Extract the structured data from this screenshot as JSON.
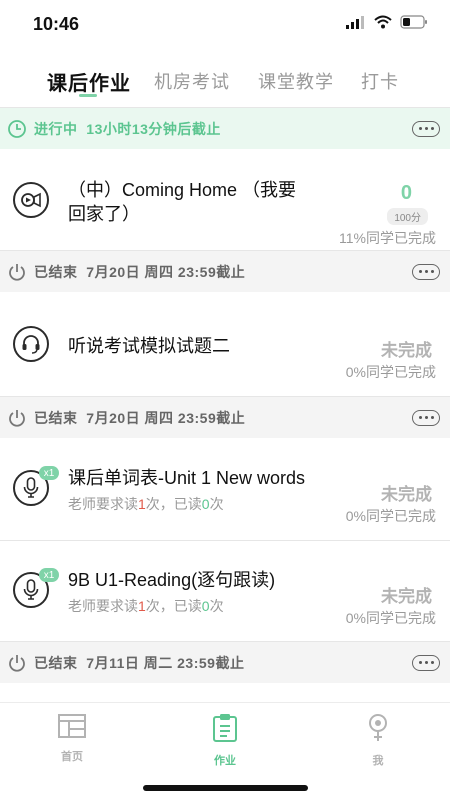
{
  "status_bar": {
    "time": "10:46"
  },
  "tabs": [
    {
      "label": "课后作业",
      "active": true
    },
    {
      "label": "机房考试",
      "active": false
    },
    {
      "label": "课堂教学",
      "active": false
    },
    {
      "label": "打卡",
      "active": false
    }
  ],
  "sections": [
    {
      "state": "进行中",
      "deadline": "13小时13分钟后截止",
      "accent": "#5cc590"
    },
    {
      "state": "已结束",
      "deadline": "7月20日 周四 23:59截止"
    },
    {
      "state": "已结束",
      "deadline": "7月20日 周四 23:59截止"
    },
    {
      "state": "已结束",
      "deadline": "7月11日 周二 23:59截止"
    }
  ],
  "assignments": [
    {
      "icon": "video-icon",
      "title_line1": "（中）Coming Home （我要",
      "title_line2": "回家了）",
      "score": "0",
      "score_max": "100分",
      "completion": "11%同学已完成"
    },
    {
      "icon": "headset-icon",
      "title": "听说考试模拟试题二",
      "status": "未完成",
      "completion": "0%同学已完成"
    },
    {
      "icon": "microphone-icon",
      "badge": "x1",
      "title": "课后单词表-Unit 1 New words",
      "req_prefix": "老师要求读",
      "req_count": "1",
      "req_mid": "次，已读",
      "read_count": "0",
      "req_suffix": "次",
      "status": "未完成",
      "completion": "0%同学已完成"
    },
    {
      "icon": "microphone-icon",
      "badge": "x1",
      "title": "9B U1-Reading(逐句跟读)",
      "req_prefix": "老师要求读",
      "req_count": "1",
      "req_mid": "次，已读",
      "read_count": "0",
      "req_suffix": "次",
      "status": "未完成",
      "completion": "0%同学已完成"
    }
  ],
  "bottom_nav": [
    {
      "label": "首页",
      "icon": "home-grid-icon",
      "active": false
    },
    {
      "label": "作业",
      "icon": "clipboard-icon",
      "active": true
    },
    {
      "label": "我",
      "icon": "person-icon",
      "active": false
    }
  ],
  "colors": {
    "accent": "#5cc590",
    "accent_light": "#7fd3a8",
    "muted": "#b3b3b3",
    "warn": "#e15a4a"
  }
}
